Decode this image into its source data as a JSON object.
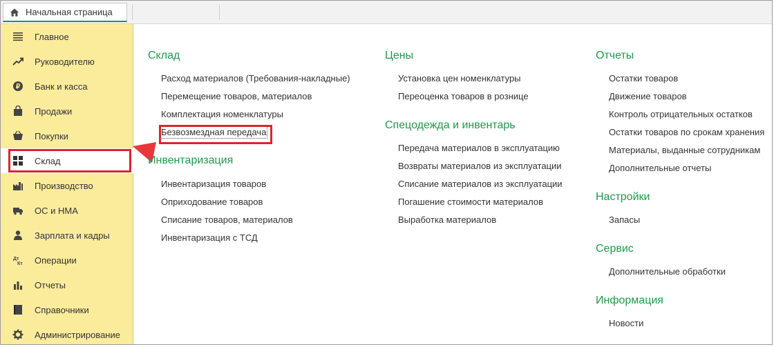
{
  "home_tab": {
    "label": "Начальная страница",
    "icon": "home-icon"
  },
  "sidebar": {
    "items": [
      {
        "label": "Главное",
        "icon": "menu-lines-icon"
      },
      {
        "label": "Руководителю",
        "icon": "trend-up-icon"
      },
      {
        "label": "Банк и касса",
        "icon": "coin-icon"
      },
      {
        "label": "Продажи",
        "icon": "shopping-bag-icon"
      },
      {
        "label": "Покупки",
        "icon": "shopping-basket-icon"
      },
      {
        "label": "Склад",
        "icon": "warehouse-grid-icon"
      },
      {
        "label": "Производство",
        "icon": "factory-icon"
      },
      {
        "label": "ОС и НМА",
        "icon": "truck-icon"
      },
      {
        "label": "Зарплата и кадры",
        "icon": "person-icon"
      },
      {
        "label": "Операции",
        "icon": "debit-credit-icon"
      },
      {
        "label": "Отчеты",
        "icon": "bar-chart-icon"
      },
      {
        "label": "Справочники",
        "icon": "book-icon"
      },
      {
        "label": "Администрирование",
        "icon": "gear-icon"
      }
    ],
    "active": "Склад"
  },
  "columns": {
    "col1": {
      "sklad": {
        "title": "Склад",
        "links": [
          "Расход материалов (Требования-накладные)",
          "Перемещение товаров, материалов",
          "Комплектация номенклатуры",
          "Безвозмездная передача"
        ]
      },
      "inventory": {
        "title": "Инвентаризация",
        "links": [
          "Инвентаризация товаров",
          "Оприходование товаров",
          "Списание товаров, материалов",
          "Инвентаризация с ТСД"
        ]
      }
    },
    "col2": {
      "prices": {
        "title": "Цены",
        "links": [
          "Установка цен номенклатуры",
          "Переоценка товаров в рознице"
        ]
      },
      "workwear": {
        "title": "Спецодежда и инвентарь",
        "links": [
          "Передача материалов в эксплуатацию",
          "Возвраты материалов из эксплуатации",
          "Списание материалов из эксплуатации",
          "Погашение стоимости материалов",
          "Выработка материалов"
        ]
      }
    },
    "col3": {
      "reports": {
        "title": "Отчеты",
        "links": [
          "Остатки товаров",
          "Движение товаров",
          "Контроль отрицательных остатков",
          "Остатки товаров по срокам хранения",
          "Материалы, выданные сотрудникам",
          "Дополнительные отчеты"
        ]
      },
      "settings": {
        "title": "Настройки",
        "links": [
          "Запасы"
        ]
      },
      "service": {
        "title": "Сервис",
        "links": [
          "Дополнительные обработки"
        ]
      },
      "info": {
        "title": "Информация",
        "links": [
          "Новости"
        ]
      }
    }
  },
  "colors": {
    "accent_green": "#1f9a4a",
    "sidebar_bg": "#fbec9c",
    "highlight_red": "#d9262a"
  }
}
